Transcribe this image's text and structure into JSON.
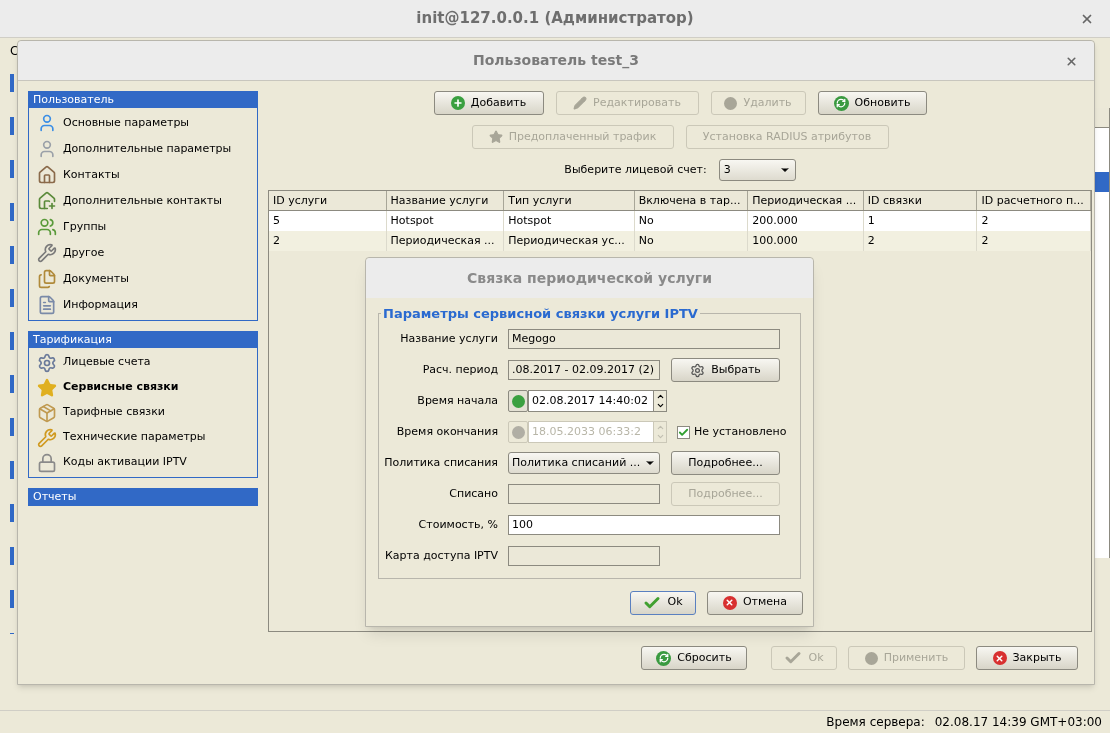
{
  "main_window": {
    "title": "init@127.0.0.1 (Администратор)",
    "menu_fragment": "С"
  },
  "user_dialog": {
    "title": "Пользователь test_3",
    "sidebar": [
      {
        "header": "Пользователь",
        "items": [
          {
            "label": "Основные параметры",
            "selected": false
          },
          {
            "label": "Дополнительные параметры",
            "selected": false
          },
          {
            "label": "Контакты",
            "selected": false
          },
          {
            "label": "Дополнительные контакты",
            "selected": false
          },
          {
            "label": "Группы",
            "selected": false
          },
          {
            "label": "Другое",
            "selected": false
          },
          {
            "label": "Документы",
            "selected": false
          },
          {
            "label": "Информация",
            "selected": false
          }
        ]
      },
      {
        "header": "Тарификация",
        "items": [
          {
            "label": "Лицевые счета",
            "selected": false
          },
          {
            "label": "Сервисные связки",
            "selected": true
          },
          {
            "label": "Тарифные связки",
            "selected": false
          },
          {
            "label": "Технические параметры",
            "selected": false
          },
          {
            "label": "Коды активации IPTV",
            "selected": false
          }
        ]
      },
      {
        "header": "Отчеты"
      }
    ],
    "toolbar_rows": [
      [
        {
          "label": "Добавить",
          "disabled": false
        },
        {
          "label": "Редактировать",
          "disabled": true
        },
        {
          "label": "Удалить",
          "disabled": true
        },
        {
          "label": "Обновить",
          "disabled": false
        }
      ],
      [
        {
          "label": "Предоплаченный трафик",
          "disabled": true
        },
        {
          "label": "Установка RADIUS атрибутов",
          "disabled": true
        }
      ]
    ],
    "account_select": {
      "label": "Выберите лицевой счет:",
      "value": "3"
    },
    "table": {
      "columns": [
        "ID услуги",
        "Название услуги",
        "Тип услуги",
        "Включена в тар...",
        "Периодическая ...",
        "ID связки",
        "ID расчетного п..."
      ],
      "rows": [
        {
          "cells": [
            "5",
            "Hotspot",
            "Hotspot",
            "No",
            "200.000",
            "1",
            "2"
          ]
        },
        {
          "cells": [
            "2",
            "Периодическая ...",
            "Периодическая ус...",
            "No",
            "100.000",
            "2",
            "2"
          ]
        }
      ]
    },
    "buttons": [
      {
        "label": "Сбросить",
        "disabled": false
      },
      {
        "label": "Ok",
        "disabled": true
      },
      {
        "label": "Применить",
        "disabled": true
      },
      {
        "label": "Закрыть",
        "disabled": false
      }
    ]
  },
  "link_dialog": {
    "title": "Связка периодической услуги",
    "legend": "Параметры сервисной связки услуги IPTV",
    "fields": [
      {
        "kind": "text",
        "label": "Название услуги",
        "value": "Megogo",
        "editable": false
      },
      {
        "kind": "text_button",
        "label": "Расч. период",
        "value": ".08.2017 - 02.09.2017 (2)",
        "button": {
          "label": "Выбрать",
          "disabled": false
        }
      },
      {
        "kind": "datetime",
        "label": "Время начала",
        "value": "02.08.2017 14:40:02",
        "disabled": false
      },
      {
        "kind": "datetime",
        "label": "Время окончания",
        "value": "18.05.2033 06:33:2",
        "disabled": true,
        "checkbox": {
          "label": "Не установлено",
          "checked": true
        }
      },
      {
        "kind": "select_button",
        "label": "Политика списания",
        "value": "Политика списаний ...",
        "button": {
          "label": "Подробнее...",
          "disabled": false
        }
      },
      {
        "kind": "text_button",
        "label": "Списано",
        "button": {
          "label": "Подробнее...",
          "disabled": true
        }
      },
      {
        "kind": "text",
        "label": "Стоимость, %",
        "value": "100",
        "editable": true
      },
      {
        "kind": "short_text",
        "label": "Карта доступа IPTV",
        "editable": false
      }
    ],
    "buttons": [
      {
        "label": "Ok",
        "disabled": false,
        "focused": true
      },
      {
        "label": "Отмена",
        "disabled": false,
        "focused": false
      }
    ]
  },
  "status_bar": {
    "label": "Время сервера:",
    "value": "02.08.17 14:39 GMT+03:00"
  }
}
